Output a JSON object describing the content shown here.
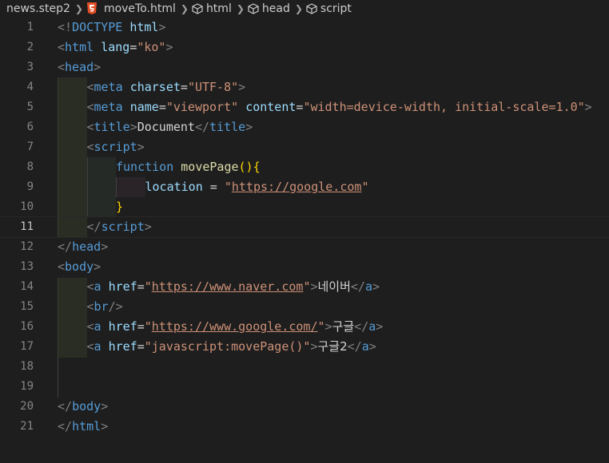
{
  "breadcrumb": {
    "folder": "news.step2",
    "file": "moveTo.html",
    "path": [
      "html",
      "head",
      "script"
    ]
  },
  "editor": {
    "current_line": 11,
    "lines": [
      {
        "n": "1",
        "parts": [
          [
            "punc",
            "<!"
          ],
          [
            "tag",
            "DOCTYPE"
          ],
          [
            "text",
            " "
          ],
          [
            "attr",
            "html"
          ],
          [
            "punc",
            ">"
          ]
        ]
      },
      {
        "n": "2",
        "parts": [
          [
            "punc",
            "<"
          ],
          [
            "tag",
            "html"
          ],
          [
            "text",
            " "
          ],
          [
            "attr",
            "lang"
          ],
          [
            "text",
            "="
          ],
          [
            "str",
            "\"ko\""
          ],
          [
            "punc",
            ">"
          ]
        ]
      },
      {
        "n": "3",
        "parts": [
          [
            "punc",
            "<"
          ],
          [
            "tag",
            "head"
          ],
          [
            "punc",
            ">"
          ]
        ]
      },
      {
        "n": "4",
        "parts": [
          [
            "punc",
            "<"
          ],
          [
            "tag",
            "meta"
          ],
          [
            "text",
            " "
          ],
          [
            "attr",
            "charset"
          ],
          [
            "text",
            "="
          ],
          [
            "str",
            "\"UTF-8\""
          ],
          [
            "punc",
            ">"
          ]
        ]
      },
      {
        "n": "5",
        "parts": [
          [
            "punc",
            "<"
          ],
          [
            "tag",
            "meta"
          ],
          [
            "text",
            " "
          ],
          [
            "attr",
            "name"
          ],
          [
            "text",
            "="
          ],
          [
            "str",
            "\"viewport\""
          ],
          [
            "text",
            " "
          ],
          [
            "attr",
            "content"
          ],
          [
            "text",
            "="
          ],
          [
            "str",
            "\"width=device-width, initial-scale=1.0\""
          ],
          [
            "punc",
            ">"
          ]
        ]
      },
      {
        "n": "6",
        "parts": [
          [
            "punc",
            "<"
          ],
          [
            "tag",
            "title"
          ],
          [
            "punc",
            ">"
          ],
          [
            "text",
            "Document"
          ],
          [
            "punc",
            "</"
          ],
          [
            "tag",
            "title"
          ],
          [
            "punc",
            ">"
          ]
        ]
      },
      {
        "n": "7",
        "parts": [
          [
            "punc",
            "<"
          ],
          [
            "tag",
            "script"
          ],
          [
            "punc",
            ">"
          ]
        ]
      },
      {
        "n": "8",
        "parts": [
          [
            "kw",
            "function"
          ],
          [
            "text",
            " "
          ],
          [
            "fn",
            "movePage"
          ],
          [
            "paren",
            "()"
          ],
          [
            "brace",
            "{"
          ]
        ]
      },
      {
        "n": "9",
        "parts": [
          [
            "var",
            "location"
          ],
          [
            "text",
            " = "
          ],
          [
            "str",
            "\""
          ],
          [
            "link",
            "https://google.com"
          ],
          [
            "str",
            "\""
          ]
        ]
      },
      {
        "n": "10",
        "parts": [
          [
            "brace",
            "}"
          ]
        ]
      },
      {
        "n": "11",
        "parts": [
          [
            "punc",
            "</"
          ],
          [
            "tag",
            "script"
          ],
          [
            "punc",
            ">"
          ]
        ]
      },
      {
        "n": "12",
        "parts": [
          [
            "punc",
            "</"
          ],
          [
            "tag",
            "head"
          ],
          [
            "punc",
            ">"
          ]
        ]
      },
      {
        "n": "13",
        "parts": [
          [
            "punc",
            "<"
          ],
          [
            "tag",
            "body"
          ],
          [
            "punc",
            ">"
          ]
        ]
      },
      {
        "n": "14",
        "parts": [
          [
            "punc",
            "<"
          ],
          [
            "tag",
            "a"
          ],
          [
            "text",
            " "
          ],
          [
            "attr",
            "href"
          ],
          [
            "text",
            "="
          ],
          [
            "str",
            "\""
          ],
          [
            "link",
            "https://www.naver.com"
          ],
          [
            "str",
            "\""
          ],
          [
            "punc",
            ">"
          ],
          [
            "ktext",
            "네이버"
          ],
          [
            "punc",
            "</"
          ],
          [
            "tag",
            "a"
          ],
          [
            "punc",
            ">"
          ]
        ]
      },
      {
        "n": "15",
        "parts": [
          [
            "punc",
            "<"
          ],
          [
            "tag",
            "br"
          ],
          [
            "punc",
            "/>"
          ]
        ]
      },
      {
        "n": "16",
        "parts": [
          [
            "punc",
            "<"
          ],
          [
            "tag",
            "a"
          ],
          [
            "text",
            " "
          ],
          [
            "attr",
            "href"
          ],
          [
            "text",
            "="
          ],
          [
            "str",
            "\""
          ],
          [
            "link",
            "https://www.google.com/"
          ],
          [
            "str",
            "\""
          ],
          [
            "punc",
            ">"
          ],
          [
            "ktext",
            "구글"
          ],
          [
            "punc",
            "</"
          ],
          [
            "tag",
            "a"
          ],
          [
            "punc",
            ">"
          ]
        ]
      },
      {
        "n": "17",
        "parts": [
          [
            "punc",
            "<"
          ],
          [
            "tag",
            "a"
          ],
          [
            "text",
            " "
          ],
          [
            "attr",
            "href"
          ],
          [
            "text",
            "="
          ],
          [
            "str",
            "\"javascript:movePage()\""
          ],
          [
            "punc",
            ">"
          ],
          [
            "ktext",
            "구글2"
          ],
          [
            "punc",
            "</"
          ],
          [
            "tag",
            "a"
          ],
          [
            "punc",
            ">"
          ]
        ]
      },
      {
        "n": "18",
        "parts": []
      },
      {
        "n": "19",
        "parts": []
      },
      {
        "n": "20",
        "parts": [
          [
            "punc",
            "</"
          ],
          [
            "tag",
            "body"
          ],
          [
            "punc",
            ">"
          ]
        ]
      },
      {
        "n": "21",
        "parts": [
          [
            "punc",
            "</"
          ],
          [
            "tag",
            "html"
          ],
          [
            "punc",
            ">"
          ]
        ]
      }
    ]
  }
}
